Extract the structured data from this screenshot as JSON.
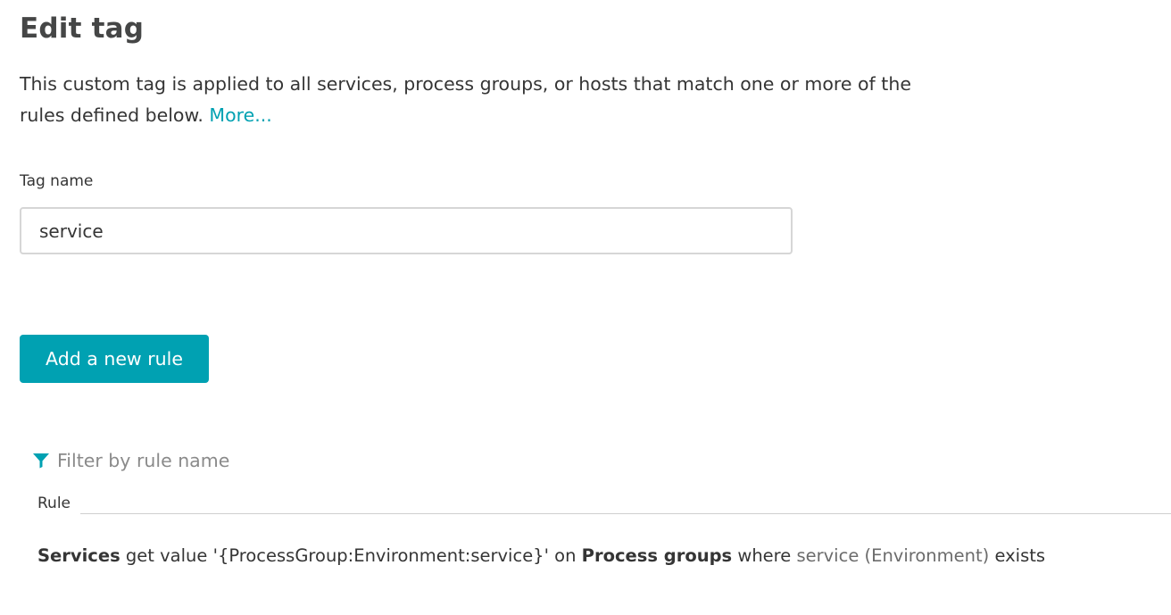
{
  "page": {
    "title": "Edit tag",
    "description": "This custom tag is applied to all services, process groups, or hosts that match one or more of the rules defined below.",
    "more_link": "More..."
  },
  "tag_form": {
    "label": "Tag name",
    "value": "service"
  },
  "actions": {
    "add_rule_label": "Add a new rule"
  },
  "filter": {
    "icon": "filter-icon",
    "placeholder": "Filter by rule name"
  },
  "rules_table": {
    "column_header": "Rule",
    "rows": [
      {
        "entity": "Services",
        "verb": "get value",
        "value": "'{ProcessGroup:Environment:service}'",
        "on": "on",
        "target": "Process groups",
        "where": "where",
        "condition": "service (Environment)",
        "operator": "exists"
      }
    ]
  },
  "colors": {
    "accent": "#00a1b2",
    "text": "#353535",
    "border": "#d6d6d6"
  }
}
